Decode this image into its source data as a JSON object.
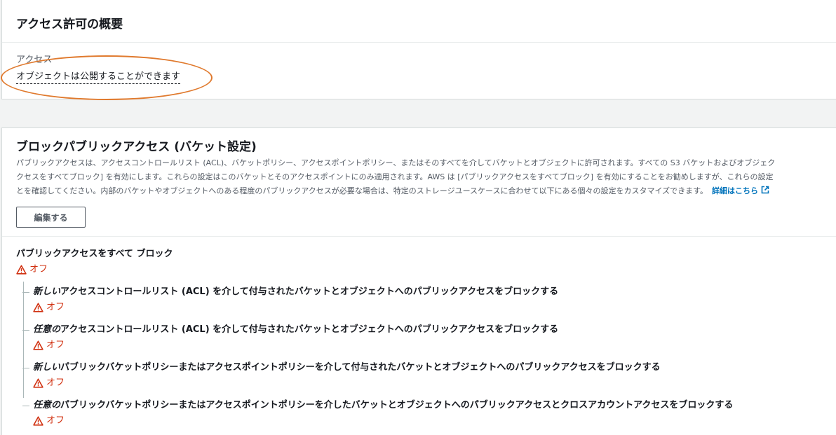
{
  "overview": {
    "title": "アクセス許可の概要",
    "access_label": "アクセス",
    "access_value": "オブジェクトは公開することができます"
  },
  "block_public_access": {
    "title": "ブロックパブリックアクセス (バケット設定)",
    "description_lines": [
      "パブリックアクセスは、アクセスコントロールリスト (ACL)、バケットポリシー、アクセスポイントポリシー、またはそのすべてを介してバケットとオブジェクトに許可されます。すべての S3 バケットおよびオブジェク",
      "クセスをすべてブロック] を有効にします。これらの設定はこのバケットとそのアクセスポイントにのみ適用されます。AWS は [パブリックアクセスをすべてブロック] を有効にすることをお勧めしますが、これらの設定",
      "とを確認してください。内部のバケットやオブジェクトへのある程度のパブリックアクセスが必要な場合は、特定のストレージユースケースに合わせて以下にある個々の設定をカスタマイズできます。"
    ],
    "learn_more": "詳細はこちら",
    "edit_button": "編集する",
    "main_setting": {
      "title": "パブリックアクセスをすべて ブロック",
      "status": "オフ"
    },
    "sub_settings": [
      {
        "emphasis": "新しい",
        "rest": "アクセスコントロールリスト (ACL) を介して付与されたバケットとオブジェクトへのパブリックアクセスをブロックする",
        "status": "オフ"
      },
      {
        "emphasis": "任意の",
        "rest": "アクセスコントロールリスト (ACL) を介して付与されたバケットとオブジェクトへのパブリックアクセスをブロックする",
        "status": "オフ"
      },
      {
        "emphasis": "新しい",
        "rest": "パブリックバケットポリシーまたはアクセスポイントポリシーを介して付与されたバケットとオブジェクトへのパブリックアクセスをブロックする",
        "status": "オフ"
      },
      {
        "emphasis": "任意の",
        "rest": "パブリックバケットポリシーまたはアクセスポイントポリシーを介したバケットとオブジェクトへのパブリックアクセスとクロスアカウントアクセスをブロックする",
        "status": "オフ"
      }
    ]
  },
  "colors": {
    "warning": "#d13212",
    "link": "#0073bb",
    "highlight": "#e07a2e"
  },
  "icons": {
    "status": "warning-icon",
    "link": "external-link-icon"
  }
}
